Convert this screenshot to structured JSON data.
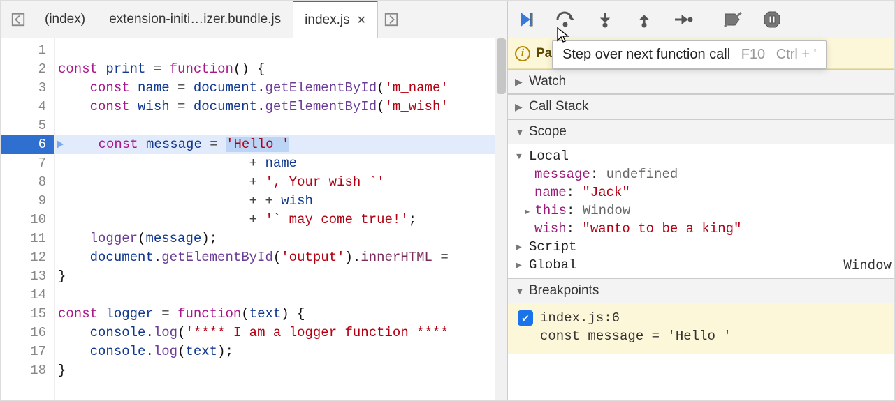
{
  "tabs": {
    "left_nav_icon": "file-nav-left-icon",
    "right_nav_icon": "file-nav-right-icon",
    "items": [
      {
        "label": "(index)",
        "active": false
      },
      {
        "label": "extension-initi…izer.bundle.js",
        "active": false
      },
      {
        "label": "index.js",
        "active": true
      }
    ]
  },
  "editor": {
    "current_line": 6,
    "selected_text": "'Hello '",
    "lines": [
      {
        "n": 1,
        "segs": []
      },
      {
        "n": 2,
        "segs": [
          [
            "kw",
            "const "
          ],
          [
            "var",
            "print"
          ],
          [
            "op",
            " = "
          ],
          [
            "kw",
            "function"
          ],
          [
            "punc",
            "() {"
          ]
        ]
      },
      {
        "n": 3,
        "segs": [
          [
            "pad",
            "    "
          ],
          [
            "kw",
            "const "
          ],
          [
            "var",
            "name"
          ],
          [
            "op",
            " = "
          ],
          [
            "var",
            "document"
          ],
          [
            "punc",
            "."
          ],
          [
            "fn",
            "getElementById"
          ],
          [
            "punc",
            "("
          ],
          [
            "str",
            "'m_name'"
          ]
        ]
      },
      {
        "n": 4,
        "segs": [
          [
            "pad",
            "    "
          ],
          [
            "kw",
            "const "
          ],
          [
            "var",
            "wish"
          ],
          [
            "op",
            " = "
          ],
          [
            "var",
            "document"
          ],
          [
            "punc",
            "."
          ],
          [
            "fn",
            "getElementById"
          ],
          [
            "punc",
            "("
          ],
          [
            "str",
            "'m_wish'"
          ]
        ]
      },
      {
        "n": 5,
        "segs": []
      },
      {
        "n": 6,
        "segs": [
          [
            "pad",
            "    "
          ],
          [
            "kw",
            "const "
          ],
          [
            "var",
            "message"
          ],
          [
            "op",
            " = "
          ],
          [
            "sel",
            "'Hello '"
          ]
        ]
      },
      {
        "n": 7,
        "segs": [
          [
            "pad",
            "                        "
          ],
          [
            "op",
            "+ "
          ],
          [
            "var",
            "name"
          ]
        ]
      },
      {
        "n": 8,
        "segs": [
          [
            "pad",
            "                        "
          ],
          [
            "op",
            "+ "
          ],
          [
            "str",
            "', Your wish `'"
          ]
        ]
      },
      {
        "n": 9,
        "segs": [
          [
            "pad",
            "                        "
          ],
          [
            "op",
            "+ + "
          ],
          [
            "var",
            "wish"
          ]
        ]
      },
      {
        "n": 10,
        "segs": [
          [
            "pad",
            "                        "
          ],
          [
            "op",
            "+ "
          ],
          [
            "str",
            "'` may come true!'"
          ],
          [
            "punc",
            ";"
          ]
        ]
      },
      {
        "n": 11,
        "segs": [
          [
            "pad",
            "    "
          ],
          [
            "fn",
            "logger"
          ],
          [
            "punc",
            "("
          ],
          [
            "var",
            "message"
          ],
          [
            "punc",
            ");"
          ]
        ]
      },
      {
        "n": 12,
        "segs": [
          [
            "pad",
            "    "
          ],
          [
            "var",
            "document"
          ],
          [
            "punc",
            "."
          ],
          [
            "fn",
            "getElementById"
          ],
          [
            "punc",
            "("
          ],
          [
            "str",
            "'output'"
          ],
          [
            "punc",
            ")."
          ],
          [
            "prop",
            "innerHTML"
          ],
          [
            "op",
            " ="
          ]
        ]
      },
      {
        "n": 13,
        "segs": [
          [
            "punc",
            "}"
          ]
        ]
      },
      {
        "n": 14,
        "segs": []
      },
      {
        "n": 15,
        "segs": [
          [
            "kw",
            "const "
          ],
          [
            "var",
            "logger"
          ],
          [
            "op",
            " = "
          ],
          [
            "kw",
            "function"
          ],
          [
            "punc",
            "("
          ],
          [
            "var",
            "text"
          ],
          [
            "punc",
            ") {"
          ]
        ]
      },
      {
        "n": 16,
        "segs": [
          [
            "pad",
            "    "
          ],
          [
            "var",
            "console"
          ],
          [
            "punc",
            "."
          ],
          [
            "fn",
            "log"
          ],
          [
            "punc",
            "("
          ],
          [
            "str",
            "'**** I am a logger function ****"
          ]
        ]
      },
      {
        "n": 17,
        "segs": [
          [
            "pad",
            "    "
          ],
          [
            "var",
            "console"
          ],
          [
            "punc",
            "."
          ],
          [
            "fn",
            "log"
          ],
          [
            "punc",
            "("
          ],
          [
            "var",
            "text"
          ],
          [
            "punc",
            ");"
          ]
        ]
      },
      {
        "n": 18,
        "segs": [
          [
            "punc",
            "}"
          ]
        ]
      }
    ]
  },
  "debugger": {
    "tooltip_text": "Step over next function call",
    "tooltip_shortcut1": "F10",
    "tooltip_shortcut2": "Ctrl + '",
    "paused_label": "Pa"
  },
  "panels": {
    "watch": "Watch",
    "callstack": "Call Stack",
    "scope": "Scope",
    "scope_local": "Local",
    "scope_vars": {
      "message": {
        "name": "message",
        "value": "undefined",
        "type": "undef"
      },
      "name": {
        "name": "name",
        "value": "\"Jack\"",
        "type": "str"
      },
      "this": {
        "name": "this",
        "value": "Window",
        "type": "obj"
      },
      "wish": {
        "name": "wish",
        "value": "\"wanto to be a king\"",
        "type": "str"
      }
    },
    "scope_script": "Script",
    "scope_global": "Global",
    "scope_global_val": "Window",
    "breakpoints": "Breakpoints",
    "bp_file": "index.js:6",
    "bp_code": "const message = 'Hello '",
    "bp_checked": true
  },
  "colors": {
    "accent": "#1a73e8",
    "kw": "#a8168c",
    "str": "#b30012"
  }
}
